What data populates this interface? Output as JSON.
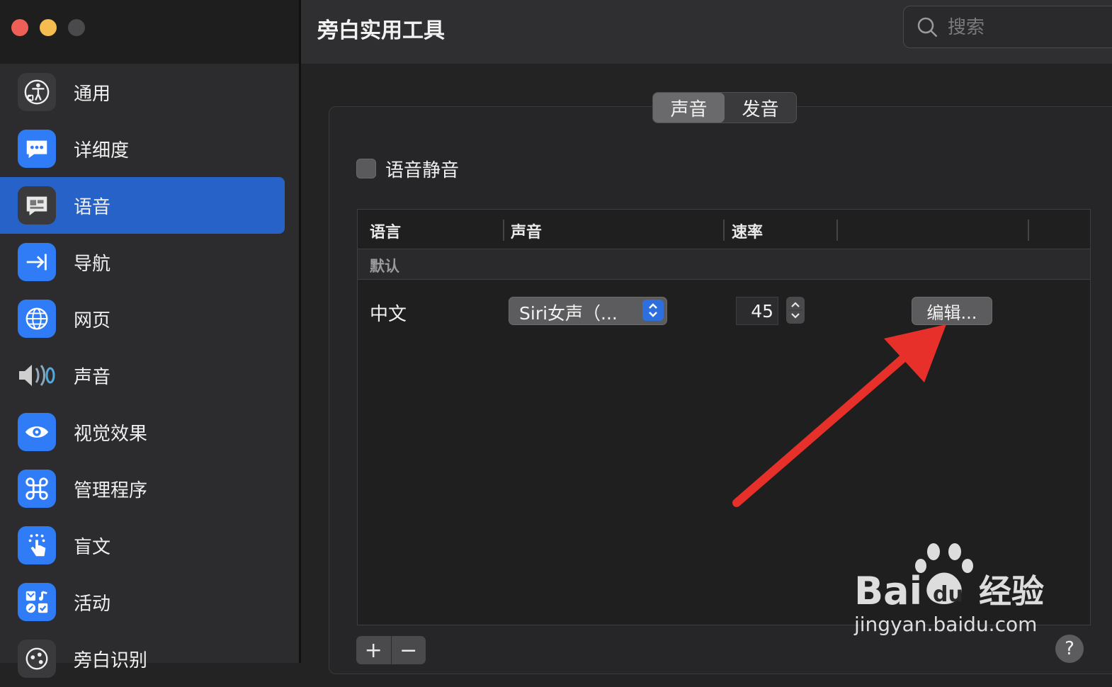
{
  "window": {
    "title": "旁白实用工具"
  },
  "search": {
    "placeholder": "搜索"
  },
  "sidebar": {
    "items": [
      {
        "label": "通用",
        "icon": "accessibility-icon",
        "color": "#3a3a3c",
        "selected": false
      },
      {
        "label": "详细度",
        "icon": "speech-bubble-dots-icon",
        "color": "#2f7cf6",
        "selected": false
      },
      {
        "label": "语音",
        "icon": "speech-bubble-icon",
        "color": "#3a3a3c",
        "selected": true
      },
      {
        "label": "导航",
        "icon": "arrow-right-bar-icon",
        "color": "#2f7cf6",
        "selected": false
      },
      {
        "label": "网页",
        "icon": "globe-icon",
        "color": "#2f7cf6",
        "selected": false
      },
      {
        "label": "声音",
        "icon": "speaker-icon",
        "color": "transparent",
        "selected": false
      },
      {
        "label": "视觉效果",
        "icon": "eye-icon",
        "color": "#2f7cf6",
        "selected": false
      },
      {
        "label": "管理程序",
        "icon": "command-icon",
        "color": "#2f7cf6",
        "selected": false
      },
      {
        "label": "盲文",
        "icon": "braille-hand-icon",
        "color": "#2f7cf6",
        "selected": false
      },
      {
        "label": "活动",
        "icon": "activities-icon",
        "color": "#2f7cf6",
        "selected": false
      },
      {
        "label": "旁白识别",
        "icon": "recognition-icon",
        "color": "#3a3a3c",
        "selected": false
      }
    ]
  },
  "tabs": [
    {
      "label": "声音",
      "active": true
    },
    {
      "label": "发音",
      "active": false
    }
  ],
  "mute": {
    "label": "语音静音",
    "checked": false
  },
  "table": {
    "headers": [
      "语言",
      "声音",
      "速率"
    ],
    "group": "默认",
    "row": {
      "language": "中文",
      "voice": "Siri女声（...",
      "rate": "45",
      "edit_label": "编辑..."
    }
  },
  "bottom": {
    "add": "+",
    "remove": "−",
    "help": "?"
  },
  "watermark": {
    "brand_a": "Bai",
    "brand_b": "du",
    "brand_c": "经验",
    "url": "jingyan.baidu.com"
  },
  "colors": {
    "accent": "#2762c8",
    "arrow": "#e8302a"
  }
}
